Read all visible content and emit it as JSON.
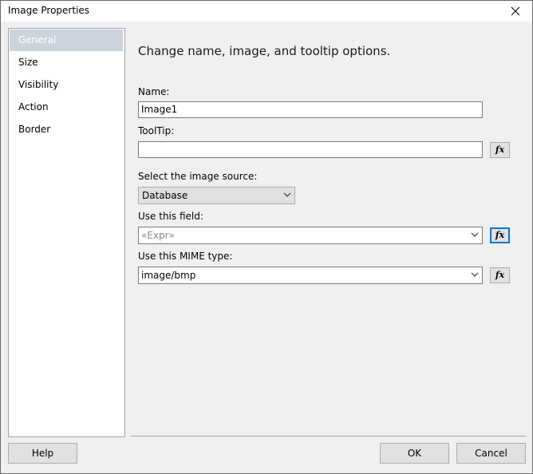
{
  "window": {
    "title": "Image Properties"
  },
  "sidebar": {
    "items": [
      {
        "label": "General",
        "selected": true
      },
      {
        "label": "Size"
      },
      {
        "label": "Visibility"
      },
      {
        "label": "Action"
      },
      {
        "label": "Border"
      }
    ]
  },
  "main": {
    "heading": "Change name, image, and tooltip options.",
    "name": {
      "label": "Name:",
      "value": "Image1"
    },
    "tooltip": {
      "label": "ToolTip:",
      "value": ""
    },
    "image_source": {
      "label": "Select the image source:",
      "value": "Database"
    },
    "field": {
      "label": "Use this field:",
      "value": "«Expr»"
    },
    "mime": {
      "label": "Use this MIME type:",
      "value": "image/bmp"
    },
    "fx_label": "fx"
  },
  "footer": {
    "help": "Help",
    "ok": "OK",
    "cancel": "Cancel"
  },
  "colors": {
    "accent": "#0078d7",
    "selected_bg": "#cdd3dc"
  }
}
